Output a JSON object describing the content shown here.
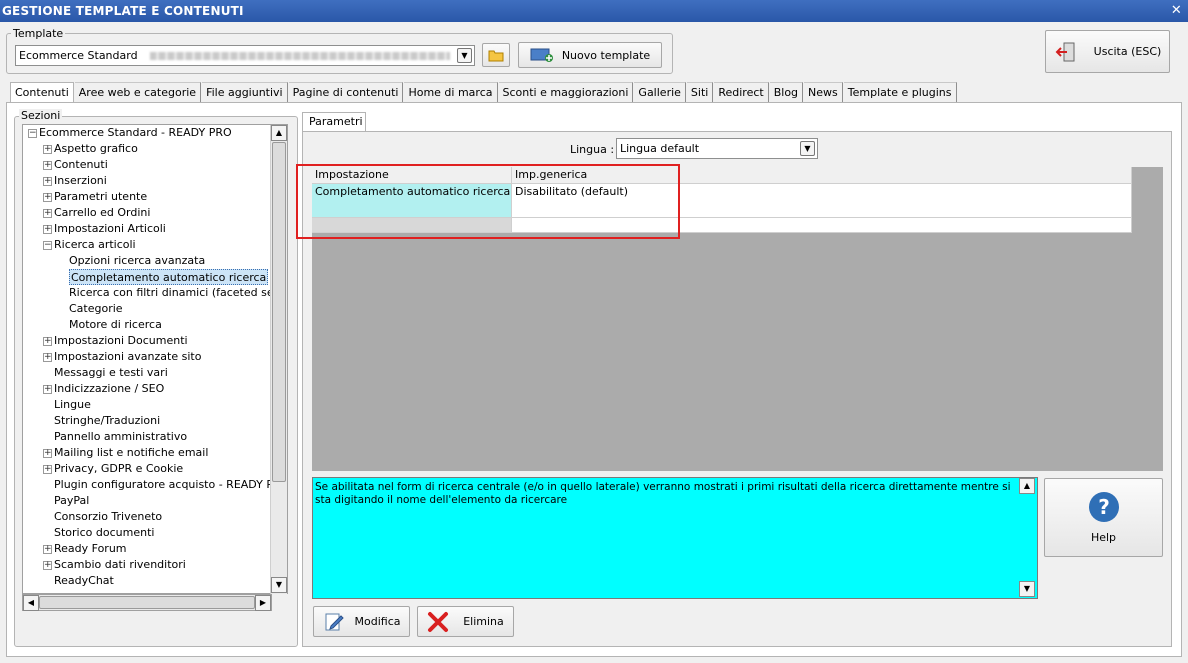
{
  "window": {
    "title": "GESTIONE TEMPLATE E CONTENUTI",
    "close_glyph": "✕"
  },
  "template": {
    "group_label": "Template",
    "selected": "Ecommerce Standard",
    "new_template_label": "Nuovo template"
  },
  "exit_button_label": "Uscita (ESC)",
  "tabs": [
    "Contenuti",
    "Aree web e categorie",
    "File aggiuntivi",
    "Pagine di contenuti",
    "Home di marca",
    "Sconti e maggiorazioni",
    "Gallerie",
    "Siti",
    "Redirect",
    "Blog",
    "News",
    "Template e plugins"
  ],
  "sections": {
    "group_label": "Sezioni",
    "root": "Ecommerce Standard - READY PRO",
    "items": [
      {
        "label": "Aspetto grafico",
        "expander": "+"
      },
      {
        "label": "Contenuti",
        "expander": "+"
      },
      {
        "label": "Inserzioni",
        "expander": "+"
      },
      {
        "label": "Parametri utente",
        "expander": "+"
      },
      {
        "label": "Carrello ed Ordini",
        "expander": "+"
      },
      {
        "label": "Impostazioni Articoli",
        "expander": "+"
      },
      {
        "label": "Ricerca articoli",
        "expander": "−"
      },
      {
        "label": "Opzioni ricerca avanzata",
        "child": true
      },
      {
        "label": "Completamento automatico ricerca",
        "child": true,
        "selected": true
      },
      {
        "label": "Ricerca con filtri dinamici (faceted search)",
        "child": true
      },
      {
        "label": "Categorie",
        "child": true
      },
      {
        "label": "Motore di ricerca",
        "child": true
      },
      {
        "label": "Impostazioni Documenti",
        "expander": "+"
      },
      {
        "label": "Impostazioni avanzate sito",
        "expander": "+"
      },
      {
        "label": "Messaggi e testi vari"
      },
      {
        "label": "Indicizzazione / SEO",
        "expander": "+"
      },
      {
        "label": "Lingue"
      },
      {
        "label": "Stringhe/Traduzioni"
      },
      {
        "label": "Pannello amministrativo"
      },
      {
        "label": "Mailing list e notifiche email",
        "expander": "+"
      },
      {
        "label": "Privacy, GDPR e Cookie",
        "expander": "+"
      },
      {
        "label": "Plugin configuratore acquisto - READY PRO"
      },
      {
        "label": "PayPal"
      },
      {
        "label": "Consorzio Triveneto"
      },
      {
        "label": "Storico documenti"
      },
      {
        "label": "Ready Forum",
        "expander": "+"
      },
      {
        "label": "Scambio dati rivenditori",
        "expander": "+"
      },
      {
        "label": "ReadyChat"
      }
    ]
  },
  "params_tab": "Parametri",
  "lingua": {
    "label": "Lingua :",
    "value": "Lingua default"
  },
  "grid": {
    "headers": [
      "Impostazione",
      "Imp.generica"
    ],
    "rows": [
      [
        "Completamento automatico ricerca",
        "Disabilitato (default)"
      ]
    ]
  },
  "description": "Se abilitata nel form di ricerca centrale (e/o in quello laterale) verranno mostrati i primi risultati della ricerca direttamente mentre si sta digitando il nome dell'elemento da ricercare",
  "help_label": "Help",
  "buttons": {
    "modify": "Modifica",
    "delete": "Elimina"
  },
  "colors": {
    "titlebar": "#2a57a8",
    "description_bg": "#00ffff",
    "row_highlight": "#b2f0f0",
    "annotation": "#e02020"
  }
}
